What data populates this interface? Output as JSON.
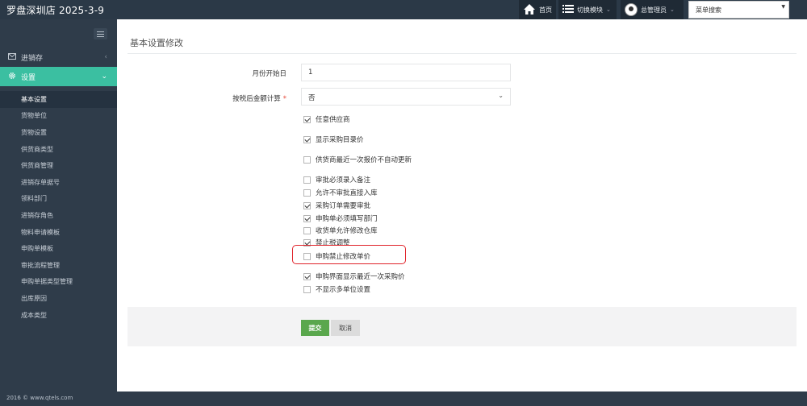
{
  "app": {
    "brand": "罗盘深圳店 2025-3-9"
  },
  "topnav": {
    "home": "首页",
    "switch_module": "切换模块",
    "user": "总管理员",
    "menu_search": "菜单搜索"
  },
  "sidebar": {
    "groups": [
      {
        "label": "进销存"
      },
      {
        "label": "设置"
      }
    ],
    "sub_items": [
      {
        "label": "基本设置"
      },
      {
        "label": "货物单位"
      },
      {
        "label": "货物设置"
      },
      {
        "label": "供货商类型"
      },
      {
        "label": "供货商管理"
      },
      {
        "label": "进销存单据号"
      },
      {
        "label": "领料部门"
      },
      {
        "label": "进销存角色"
      },
      {
        "label": "物料申请模板"
      },
      {
        "label": "申购单模板"
      },
      {
        "label": "审批流程管理"
      },
      {
        "label": "申购单据类型管理"
      },
      {
        "label": "出库原因"
      },
      {
        "label": "成本类型"
      }
    ]
  },
  "main": {
    "title": "基本设置修改",
    "month_start_label": "月份开始日",
    "month_start_value": "1",
    "tax_label": "按税后金额计算",
    "required_mark": "*",
    "tax_value": "否",
    "checkboxes": [
      {
        "label": "任意供应商",
        "checked": true
      },
      {
        "label": "显示采购目录价",
        "checked": true
      },
      {
        "label": "供货商最近一次报价不自动更新",
        "checked": false
      },
      {
        "label": "审批必须录入备注",
        "checked": false
      },
      {
        "label": "允许不审批直接入库",
        "checked": false
      },
      {
        "label": "采购订单需要审批",
        "checked": true
      },
      {
        "label": "申购单必须填写部门",
        "checked": true
      },
      {
        "label": "收货单允许修改仓库",
        "checked": false
      },
      {
        "label": "禁止税调整",
        "checked": true
      },
      {
        "label": "申购禁止修改单价",
        "checked": false
      },
      {
        "label": "申购界面显示最近一次采购价",
        "checked": true
      },
      {
        "label": "不显示多单位设置",
        "checked": false
      }
    ],
    "submit": "提交",
    "cancel": "取消"
  },
  "footer": {
    "text": "2016 © www.qtels.com"
  },
  "colors": {
    "accent": "#3bbfa1",
    "submit": "#5aa74d",
    "highlight": "#e0232a"
  }
}
